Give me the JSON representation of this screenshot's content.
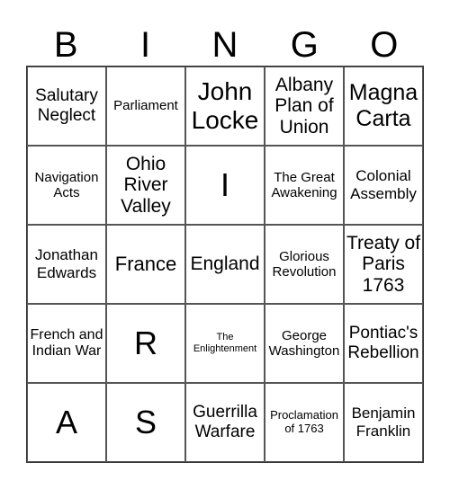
{
  "header": {
    "letters": [
      "B",
      "I",
      "N",
      "G",
      "O"
    ]
  },
  "cells": [
    [
      "Salutary Neglect",
      "Parliament",
      "John Locke",
      "Albany Plan of Union",
      "Magna Carta"
    ],
    [
      "Navigation Acts",
      "Ohio River Valley",
      "I",
      "The Great Awakening",
      "Colonial Assembly"
    ],
    [
      "Jonathan Edwards",
      "France",
      "England",
      "Glorious Revolution",
      "Treaty of Paris 1763"
    ],
    [
      "French and Indian War",
      "R",
      "The Enlightenment",
      "George Washington",
      "Pontiac's Rebellion"
    ],
    [
      "A",
      "S",
      "Guerrilla Warfare",
      "Proclamation of 1763",
      "Benjamin Franklin"
    ]
  ]
}
